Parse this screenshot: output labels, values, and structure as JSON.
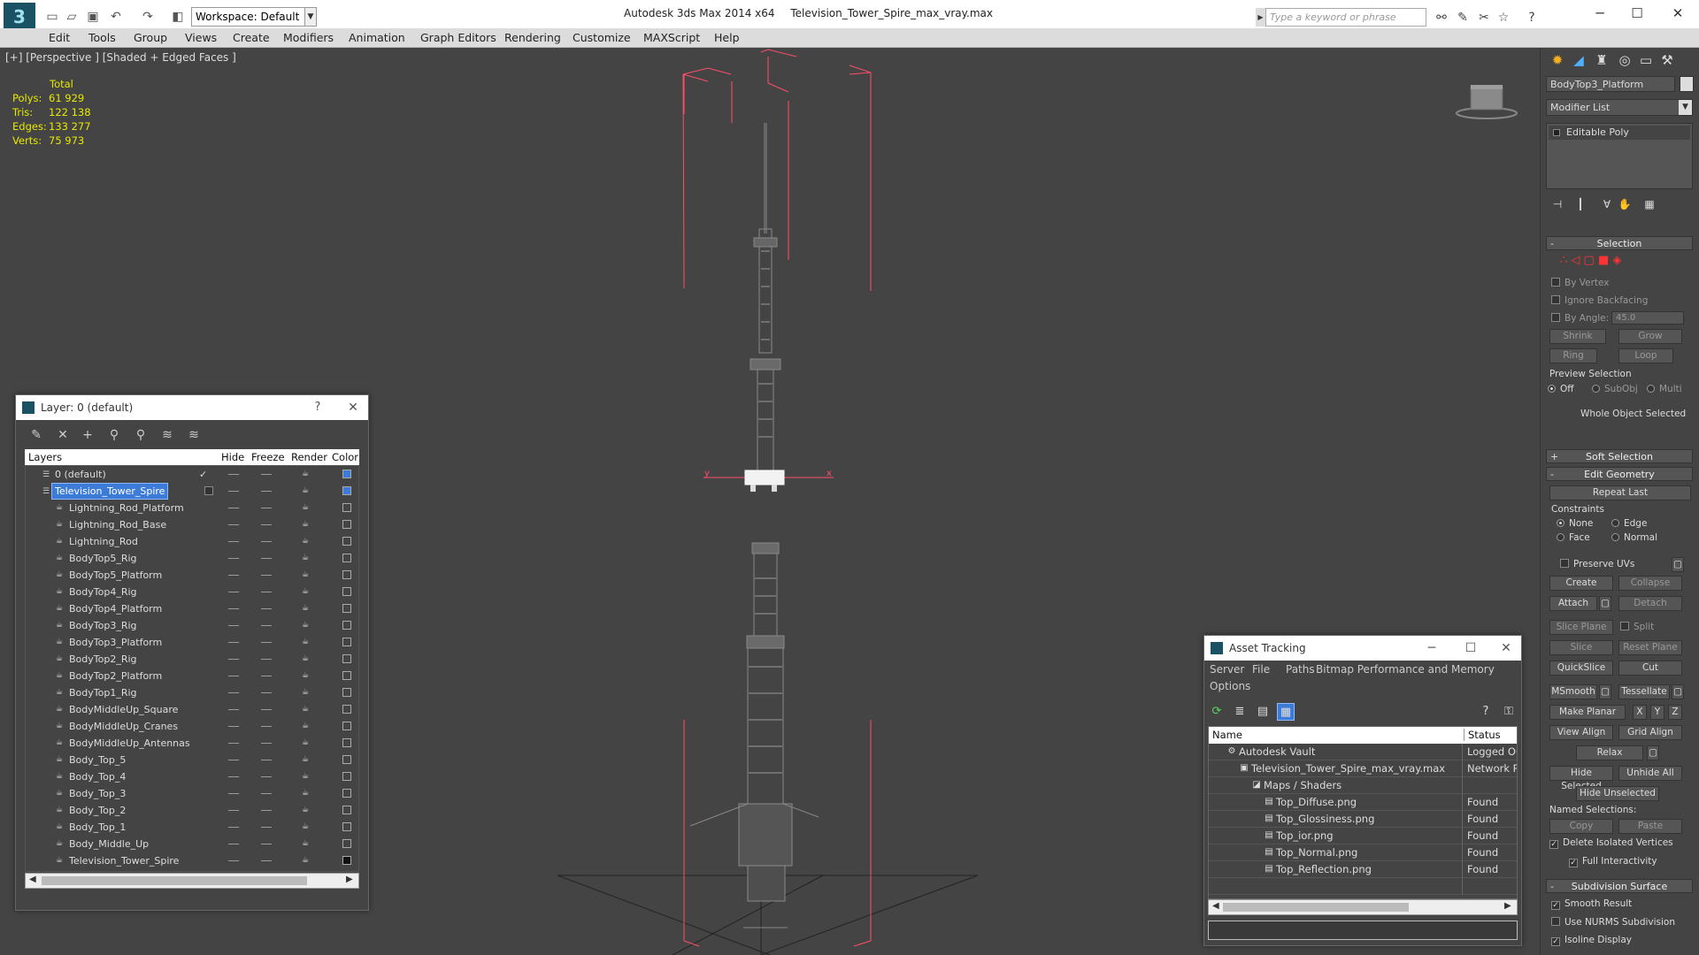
{
  "app": {
    "title": "Autodesk 3ds Max  2014 x64",
    "file": "Television_Tower_Spire_max_vray.max",
    "workspace": "Workspace: Default",
    "search_placeholder": "Type a keyword or phrase"
  },
  "menu": [
    "Edit",
    "Tools",
    "Group",
    "Views",
    "Create",
    "Modifiers",
    "Animation",
    "Graph Editors",
    "Rendering",
    "Customize",
    "MAXScript",
    "Help"
  ],
  "viewport": {
    "label": "[+] [Perspective ] [Shaded + Edged Faces ]",
    "stats": {
      "header": "Total",
      "rows": [
        {
          "label": "Polys:",
          "value": "61 929"
        },
        {
          "label": "Tris:",
          "value": "122 138"
        },
        {
          "label": "Edges:",
          "value": "133 277"
        },
        {
          "label": "Verts:",
          "value": "75 973"
        }
      ]
    },
    "gizmo": {
      "x": "x",
      "y": "y"
    }
  },
  "command_panel": {
    "object_name": "BodyTop3_Platform",
    "modifier_list": "Modifier List",
    "stack_item": "Editable Poly",
    "selection": {
      "title": "Selection",
      "by_vertex": "By Vertex",
      "ignore_backfacing": "Ignore Backfacing",
      "by_angle": "By Angle:",
      "angle_value": "45.0",
      "shrink": "Shrink",
      "grow": "Grow",
      "ring": "Ring",
      "loop": "Loop",
      "preview_selection": "Preview Selection",
      "off": "Off",
      "subobj": "SubObj",
      "multi": "Multi",
      "whole_object": "Whole Object Selected"
    },
    "soft_selection": "Soft Selection",
    "edit_geometry": {
      "title": "Edit Geometry",
      "repeat_last": "Repeat Last",
      "constraints": "Constraints",
      "none": "None",
      "edge": "Edge",
      "face": "Face",
      "normal": "Normal",
      "preserve_uvs": "Preserve UVs",
      "create": "Create",
      "collapse": "Collapse",
      "attach": "Attach",
      "detach": "Detach",
      "slice_plane": "Slice Plane",
      "split": "Split",
      "slice": "Slice",
      "reset_plane": "Reset Plane",
      "quickslice": "QuickSlice",
      "cut": "Cut",
      "msmooth": "MSmooth",
      "tessellate": "Tessellate",
      "make_planar": "Make Planar",
      "x": "X",
      "y": "Y",
      "z": "Z",
      "view_align": "View Align",
      "grid_align": "Grid Align",
      "relax": "Relax",
      "hide_selected": "Hide Selected",
      "unhide_all": "Unhide All",
      "hide_unselected": "Hide Unselected",
      "named_selections": "Named Selections:",
      "copy": "Copy",
      "paste": "Paste",
      "delete_isolated": "Delete Isolated Vertices",
      "full_interactivity": "Full Interactivity"
    },
    "subdivision": {
      "title": "Subdivision Surface",
      "smooth_result": "Smooth Result",
      "use_nurms": "Use NURMS Subdivision",
      "isoline": "Isoline Display"
    }
  },
  "layer_dialog": {
    "title": "Layer: 0 (default)",
    "help": "?",
    "columns": {
      "layers": "Layers",
      "hide": "Hide",
      "freeze": "Freeze",
      "render": "Render",
      "color": "Color"
    },
    "layers": [
      {
        "name": "0 (default)",
        "kind": "layer",
        "color": "#3d7bd8"
      },
      {
        "name": "Television_Tower_Spire",
        "kind": "layer",
        "selected": true,
        "color": "#3d7bd8"
      },
      {
        "name": "Lightning_Rod_Platform",
        "kind": "object",
        "color": "#444444"
      },
      {
        "name": "Lightning_Rod_Base",
        "kind": "object",
        "color": "#444444"
      },
      {
        "name": "Lightning_Rod",
        "kind": "object",
        "color": "#444444"
      },
      {
        "name": "BodyTop5_Rig",
        "kind": "object",
        "color": "#444444"
      },
      {
        "name": "BodyTop5_Platform",
        "kind": "object",
        "color": "#444444"
      },
      {
        "name": "BodyTop4_Rig",
        "kind": "object",
        "color": "#444444"
      },
      {
        "name": "BodyTop4_Platform",
        "kind": "object",
        "color": "#444444"
      },
      {
        "name": "BodyTop3_Rig",
        "kind": "object",
        "color": "#444444"
      },
      {
        "name": "BodyTop3_Platform",
        "kind": "object",
        "color": "#444444"
      },
      {
        "name": "BodyTop2_Rig",
        "kind": "object",
        "color": "#444444"
      },
      {
        "name": "BodyTop2_Platform",
        "kind": "object",
        "color": "#444444"
      },
      {
        "name": "BodyTop1_Rig",
        "kind": "object",
        "color": "#444444"
      },
      {
        "name": "BodyMiddleUp_Square",
        "kind": "object",
        "color": "#444444"
      },
      {
        "name": "BodyMiddleUp_Cranes",
        "kind": "object",
        "color": "#444444"
      },
      {
        "name": "BodyMiddleUp_Antennas",
        "kind": "object",
        "color": "#444444"
      },
      {
        "name": "Body_Top_5",
        "kind": "object",
        "color": "#444444"
      },
      {
        "name": "Body_Top_4",
        "kind": "object",
        "color": "#444444"
      },
      {
        "name": "Body_Top_3",
        "kind": "object",
        "color": "#444444"
      },
      {
        "name": "Body_Top_2",
        "kind": "object",
        "color": "#444444"
      },
      {
        "name": "Body_Top_1",
        "kind": "object",
        "color": "#444444"
      },
      {
        "name": "Body_Middle_Up",
        "kind": "object",
        "color": "#444444"
      },
      {
        "name": "Television_Tower_Spire",
        "kind": "object",
        "color": "#111111"
      }
    ]
  },
  "asset_tracking": {
    "title": "Asset Tracking",
    "menu": [
      "Server",
      "File",
      "Paths",
      "Bitmap Performance and Memory",
      "Options"
    ],
    "columns": {
      "name": "Name",
      "status": "Status"
    },
    "rows": [
      {
        "name": "Autodesk Vault",
        "status": "Logged Out",
        "indent": 1
      },
      {
        "name": "Television_Tower_Spire_max_vray.max",
        "status": "Network Pa",
        "indent": 2
      },
      {
        "name": "Maps / Shaders",
        "status": "",
        "indent": 3
      },
      {
        "name": "Top_Diffuse.png",
        "status": "Found",
        "indent": 4
      },
      {
        "name": "Top_Glossiness.png",
        "status": "Found",
        "indent": 4
      },
      {
        "name": "Top_ior.png",
        "status": "Found",
        "indent": 4
      },
      {
        "name": "Top_Normal.png",
        "status": "Found",
        "indent": 4
      },
      {
        "name": "Top_Reflection.png",
        "status": "Found",
        "indent": 4
      }
    ]
  }
}
